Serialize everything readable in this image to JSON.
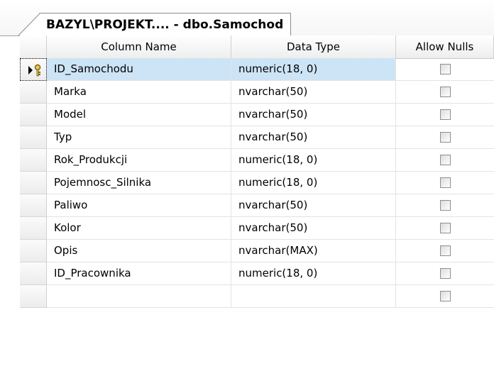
{
  "tab": {
    "title": "BAZYL\\PROJEKT.... - dbo.Samochod"
  },
  "columns": {
    "name": "Column Name",
    "type": "Data Type",
    "nulls": "Allow Nulls"
  },
  "rows": [
    {
      "name": "ID_Samochodu",
      "type": "numeric(18, 0)",
      "allow_nulls": false,
      "primary_key": true
    },
    {
      "name": "Marka",
      "type": "nvarchar(50)",
      "allow_nulls": false
    },
    {
      "name": "Model",
      "type": "nvarchar(50)",
      "allow_nulls": false
    },
    {
      "name": "Typ",
      "type": "nvarchar(50)",
      "allow_nulls": false
    },
    {
      "name": "Rok_Produkcji",
      "type": "numeric(18, 0)",
      "allow_nulls": false
    },
    {
      "name": "Pojemnosc_Silnika",
      "type": "numeric(18, 0)",
      "allow_nulls": false
    },
    {
      "name": "Paliwo",
      "type": "nvarchar(50)",
      "allow_nulls": false
    },
    {
      "name": "Kolor",
      "type": "nvarchar(50)",
      "allow_nulls": false
    },
    {
      "name": "Opis",
      "type": "nvarchar(MAX)",
      "allow_nulls": false
    },
    {
      "name": "ID_Pracownika",
      "type": "numeric(18, 0)",
      "allow_nulls": false
    },
    {
      "name": "",
      "type": "",
      "allow_nulls": false
    }
  ],
  "selection_color": "#cde4f7"
}
